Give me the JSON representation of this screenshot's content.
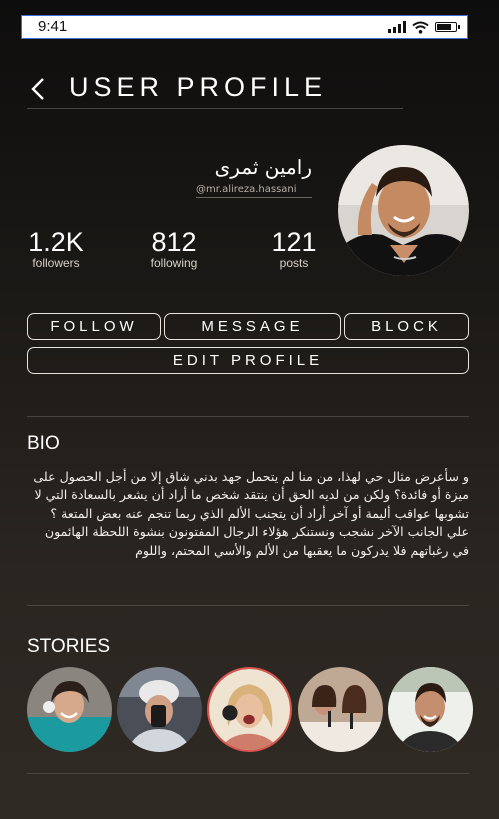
{
  "status": {
    "time": "9:41",
    "battery_level": 0.85
  },
  "header": {
    "title": "USER PROFILE",
    "back_icon": "chevron-left-icon"
  },
  "profile": {
    "name": "رامين ثمرى",
    "handle": "@mr.alireza.hassani",
    "stats": [
      {
        "value": "1.2K",
        "label": "followers"
      },
      {
        "value": "812",
        "label": "following"
      },
      {
        "value": "121",
        "label": "posts"
      }
    ]
  },
  "actions": {
    "follow": "FOLLOW",
    "message": "MESSAGE",
    "block": "BLOCK",
    "edit_profile": "EDIT PROFILE"
  },
  "bio": {
    "title": "BIO",
    "paragraphs": [
      "و سأعرض مثال حي لهذا، من منا لم يتحمل جهد بدني شاق إلا من أجل الحصول على ميزة أو فائدة؟ ولكن من لديه الحق أن ينتقد شخص ما أراد أن يشعر بالسعادة التي لا تشوبها عواقب أليمة أو آخر أراد أن يتجنب الألم الذي ربما تنجم عنه بعض المتعة ؟",
      "علي الجانب الآخر نشجب ونستنكر هؤلاء الرجال المفتونون بنشوة اللحظة الهائمون في رغباتهم فلا يدركون ما يعقبها من الألم والأسي المحتم، واللوم"
    ]
  },
  "stories": {
    "title": "STORIES",
    "count": 5
  },
  "colors": {
    "background": "#1b1916",
    "accent_ring": "#d9534f",
    "text": "#ffffff"
  }
}
